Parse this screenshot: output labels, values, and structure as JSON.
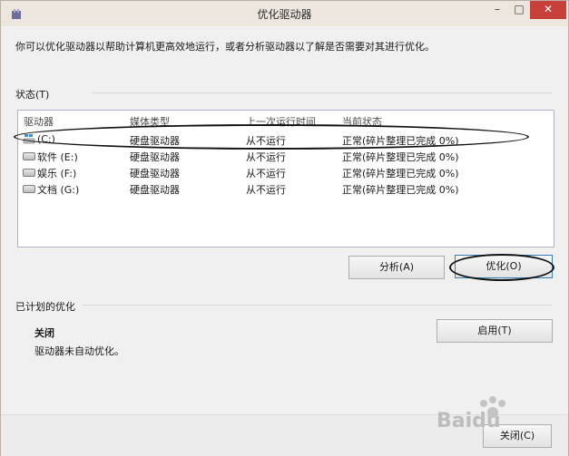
{
  "window": {
    "title": "优化驱动器"
  },
  "description": "你可以优化驱动器以帮助计算机更高效地运行，或者分析驱动器以了解是否需要对其进行优化。",
  "status": {
    "label": "状态(T)",
    "columns": [
      "驱动器",
      "媒体类型",
      "上一次运行时间",
      "当前状态"
    ],
    "rows": [
      {
        "drive": "(C:)",
        "media": "硬盘驱动器",
        "last_run": "从不运行",
        "status": "正常(碎片整理已完成 0%)",
        "icon": "windows-drive-icon"
      },
      {
        "drive": "软件 (E:)",
        "media": "硬盘驱动器",
        "last_run": "从不运行",
        "status": "正常(碎片整理已完成 0%)",
        "icon": "hard-drive-icon"
      },
      {
        "drive": "娱乐 (F:)",
        "media": "硬盘驱动器",
        "last_run": "从不运行",
        "status": "正常(碎片整理已完成 0%)",
        "icon": "hard-drive-icon"
      },
      {
        "drive": "文档 (G:)",
        "media": "硬盘驱动器",
        "last_run": "从不运行",
        "status": "正常(碎片整理已完成 0%)",
        "icon": "hard-drive-icon"
      }
    ]
  },
  "buttons": {
    "analyze": "分析(A)",
    "optimize": "优化(O)"
  },
  "scheduled": {
    "label": "已计划的优化",
    "state": "关闭",
    "detail": "驱动器未自动优化。",
    "enable_button": "启用(T)"
  },
  "footer": {
    "close_button": "关闭(C)"
  },
  "watermark": "Baidu"
}
